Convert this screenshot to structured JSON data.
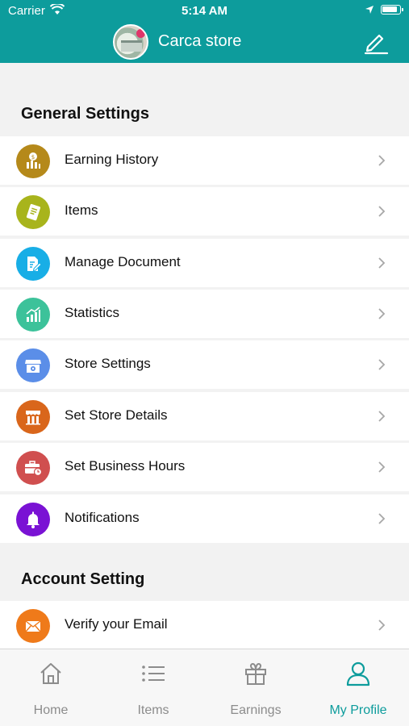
{
  "status_bar": {
    "carrier": "Carrier",
    "time": "5:14 AM"
  },
  "header": {
    "store_name": "Carca store"
  },
  "sections": {
    "general": "General Settings",
    "account": "Account Setting"
  },
  "general_items": [
    {
      "label": "Earning History",
      "icon": "earning-history-icon",
      "color": "#b5891a"
    },
    {
      "label": "Items",
      "icon": "items-icon",
      "color": "#a8b41c"
    },
    {
      "label": "Manage Document",
      "icon": "document-icon",
      "color": "#18aee6"
    },
    {
      "label": "Statistics",
      "icon": "statistics-icon",
      "color": "#3cc29a"
    },
    {
      "label": "Store Settings",
      "icon": "store-icon",
      "color": "#5b8ee8"
    },
    {
      "label": "Set Store Details",
      "icon": "storefront-icon",
      "color": "#d9661b"
    },
    {
      "label": "Set Business Hours",
      "icon": "briefcase-clock-icon",
      "color": "#d04f4f"
    },
    {
      "label": "Notifications",
      "icon": "bell-icon",
      "color": "#7a12d4"
    }
  ],
  "account_items": [
    {
      "label": "Verify your Email",
      "icon": "envelope-icon",
      "color": "#ef7a1a"
    }
  ],
  "tabs": [
    {
      "label": "Home",
      "icon": "home-icon"
    },
    {
      "label": "Items",
      "icon": "list-icon"
    },
    {
      "label": "Earnings",
      "icon": "gift-icon"
    },
    {
      "label": "My Profile",
      "icon": "user-icon",
      "active": true
    }
  ],
  "colors": {
    "primary": "#0d9c9c",
    "background": "#f2f2f2",
    "inactive": "#8c8c8c"
  }
}
